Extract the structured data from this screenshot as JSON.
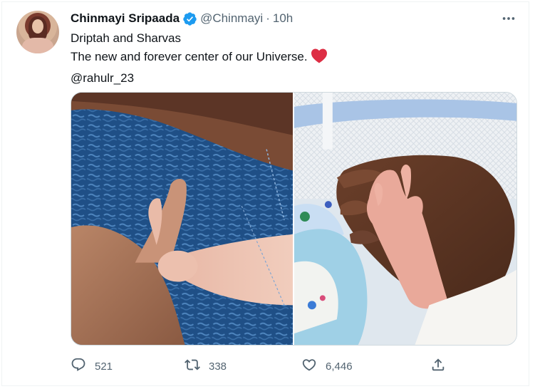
{
  "tweet": {
    "author_name": "Chinmayi Sripaada",
    "handle": "@Chinmayi",
    "separator": "·",
    "time": "10h",
    "text_line1": "Driptah and Sharvas",
    "text_line2": "The new and forever center of our Universe.",
    "mention": "@rahulr_23",
    "emoji_icon": "red-heart-icon",
    "verified_icon": "verified-badge-icon",
    "more_icon": "more-dots-icon"
  },
  "media": {
    "images": [
      {
        "name": "photo-left",
        "subject": "baby-hand-holding-finger"
      },
      {
        "name": "photo-right",
        "subject": "baby-hand-in-adult-hand"
      }
    ]
  },
  "actions": {
    "reply_count": "521",
    "retweet_count": "338",
    "like_count": "6,446",
    "reply_icon": "reply-icon",
    "retweet_icon": "retweet-icon",
    "like_icon": "heart-icon",
    "share_icon": "share-icon"
  },
  "colors": {
    "text": "#0f1419",
    "secondary": "#536471",
    "verified": "#1d9bf0",
    "heart": "#e0245e"
  }
}
